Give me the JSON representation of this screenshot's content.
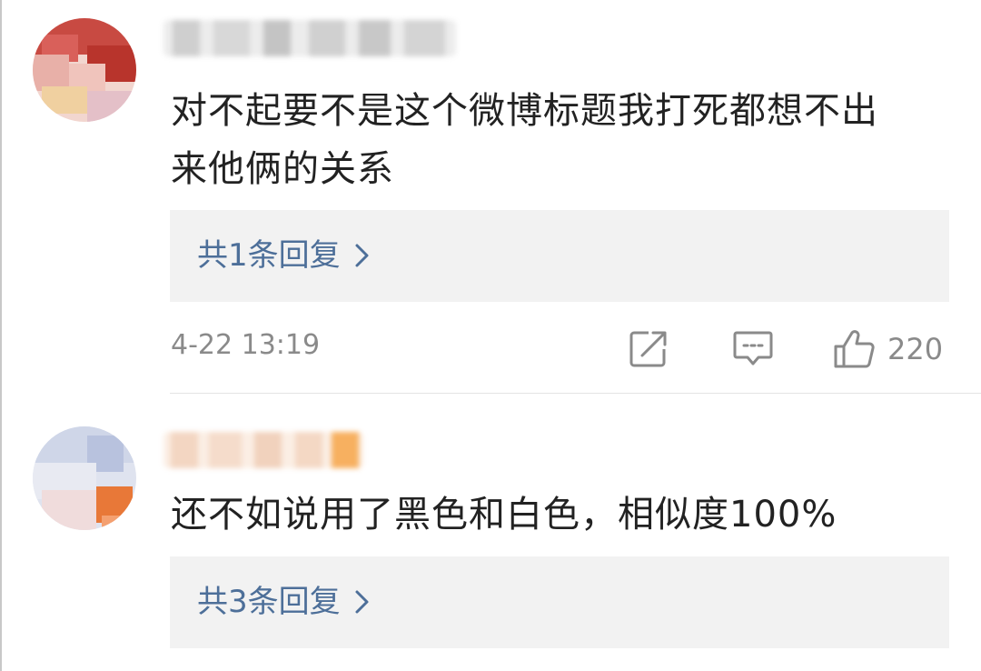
{
  "comments": [
    {
      "username_hidden": true,
      "text_line1": "对不起要不是这个微博标题我打死都想不出",
      "text_line2": "来他俩的关系",
      "reply_link": "共1条回复",
      "timestamp": "4-22 13:19",
      "like_count": "220",
      "icons": [
        "repost-icon",
        "comment-icon",
        "like-icon"
      ]
    },
    {
      "username_hidden": true,
      "text_line1": "还不如说用了黑色和白色，相似度100%",
      "reply_link": "共3条回复"
    }
  ],
  "colors": {
    "link": "#4d6f99",
    "meta": "#8a8a8a",
    "reply_bg": "#f2f2f2",
    "text": "#222222"
  }
}
